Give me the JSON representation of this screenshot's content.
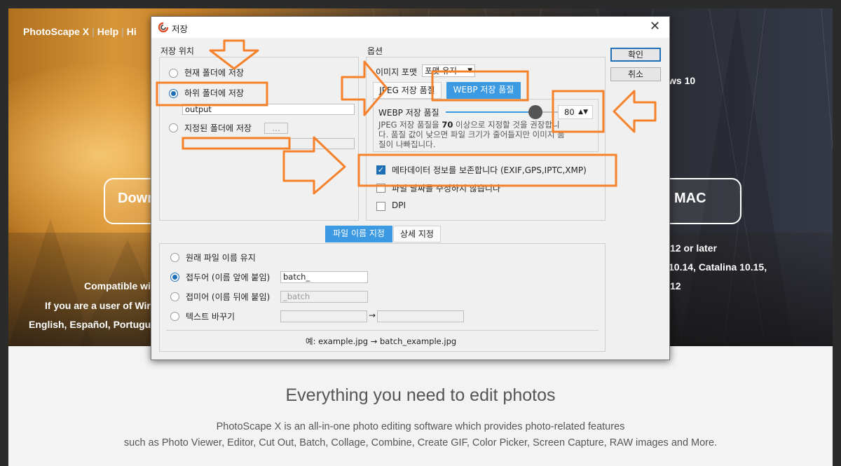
{
  "website": {
    "nav": [
      "PhotoScape X",
      "Help",
      "Hi"
    ],
    "hero_right_text": "ws 10",
    "download_left_label": "Dowr",
    "download_right_label": "MAC",
    "compat_left": [
      "Compatible wi",
      "If you are a user of Wir",
      "English, Español, Portugu"
    ],
    "compat_right": [
      "12 or later",
      "10.14, Catalina 10.15,",
      "12"
    ],
    "headline": "Everything you need to edit photos",
    "description": [
      "PhotoScape X is an all-in-one photo editing software which provides photo-related features",
      "such as Photo Viewer, Editor, Cut Out, Batch, Collage, Combine, Create GIF, Color Picker, Screen Capture, RAW images and More."
    ]
  },
  "dialog": {
    "title": "저장",
    "close_glyph": "✕",
    "ok_label": "확인",
    "cancel_label": "취소",
    "save_location": {
      "label": "저장 위치",
      "current_folder": "현재 폴더에 저장",
      "sub_folder": "하위 폴더에 저장",
      "sub_folder_value": "output",
      "specified_folder": "지정된 폴더에 저장",
      "browse_label": "..."
    },
    "options": {
      "label": "옵션",
      "image_format_label": "이미지 포맷",
      "image_format_value": "포맷 유지",
      "tab_jpeg": "JPEG 저장 품질",
      "tab_webp": "WEBP 저장 품질",
      "webp_quality_label": "WEBP 저장 품질",
      "webp_quality": 80,
      "webp_quality_text": "80",
      "hint_line1_pre": "JPEG 저장 품질을 ",
      "hint_line1_bold": "70",
      "hint_line1_post": " 이상으로 지정할 것을 권장합니",
      "hint_line2": "다. 품질 값이 낮으면 파일 크기가 줄어들지만 이미지 품",
      "hint_line3": "질이 나빠집니다.",
      "metadata_label": "메타데이터 정보를 보존합니다 (EXIF,GPS,IPTC,XMP)",
      "metadata_checked": true,
      "file_date_label": "파일 날짜를 수정하지 않습니다",
      "file_date_checked": false,
      "dpi_label": "DPI",
      "dpi_checked": false
    },
    "filename": {
      "tab_name": "파일 이름 지정",
      "tab_detail": "상세 지정",
      "keep_original": "원래 파일 이름 유지",
      "prefix_label": "접두어 (이름 앞에 붙임)",
      "prefix_value": "batch_",
      "suffix_label": "접미어 (이름 뒤에 붙임)",
      "suffix_placeholder": "_batch",
      "replace_label": "텍스트 바꾸기",
      "replace_arrow": "→",
      "example": "예: example.jpg → batch_example.jpg"
    }
  },
  "colors": {
    "annotation": "#f5822a",
    "accent": "#3b9ae1",
    "radio_selected": "#1f6fb7"
  }
}
